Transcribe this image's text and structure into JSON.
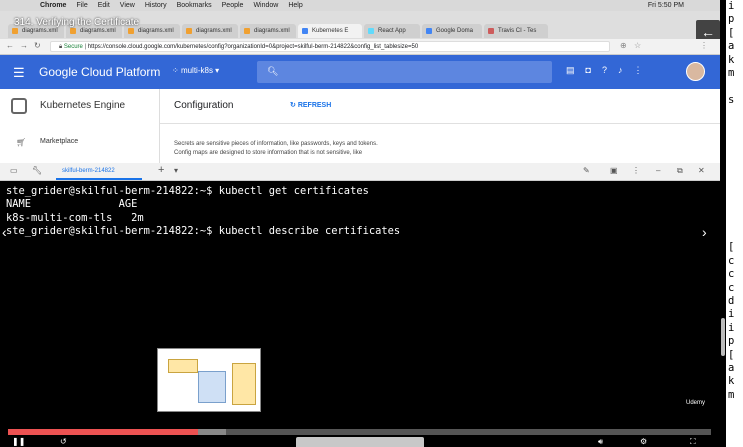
{
  "os_menubar": {
    "items": [
      "Chrome",
      "File",
      "Edit",
      "View",
      "History",
      "Bookmarks",
      "People",
      "Window",
      "Help"
    ],
    "clock": "Fri 5:50 PM"
  },
  "video": {
    "title": "314. Verifying the Certificate",
    "watermark": "Udemy",
    "progress_played": 0.27,
    "progress_loaded": 0.31
  },
  "browser": {
    "tabs": [
      {
        "label": "diagrams.xml",
        "color": "#f0a030"
      },
      {
        "label": "diagrams.xml",
        "color": "#f0a030"
      },
      {
        "label": "diagrams.xml",
        "color": "#f0a030"
      },
      {
        "label": "diagrams.xml",
        "color": "#f0a030"
      },
      {
        "label": "diagrams.xml",
        "color": "#f0a030"
      },
      {
        "label": "Kubernetes E",
        "color": "#4285f4"
      },
      {
        "label": "React App",
        "color": "#61dafb"
      },
      {
        "label": "Google Doma",
        "color": "#4285f4"
      },
      {
        "label": "Travis CI - Tes",
        "color": "#cd5c5c"
      }
    ],
    "secure_label": "Secure",
    "url": "https://console.cloud.google.com/kubernetes/config?organizationId=0&project=skilful-berm-214822&config_list_tablesize=50"
  },
  "gcp": {
    "brand": "Google Cloud Platform",
    "project": "multi-k8s",
    "sidebar": {
      "product": "Kubernetes Engine",
      "items": [
        "Marketplace"
      ]
    },
    "page_title": "Configuration",
    "refresh_label": "REFRESH",
    "description_lines": [
      "Secrets are sensitive pieces of information, like passwords, keys and tokens.",
      "Config maps are designed to store information that is not sensitive, like"
    ]
  },
  "cloud_shell": {
    "tab_label": "skilful-berm-214822",
    "add_tab": "+"
  },
  "terminal": {
    "lines": [
      "ste_grider@skilful-berm-214822:~$ kubectl get certificates",
      "NAME              AGE",
      "k8s-multi-com-tls   2m",
      "ste_grider@skilful-berm-214822:~$ kubectl describe certificates"
    ]
  },
  "right_strip": {
    "text": "i\np\n[\na\nk\nm\n\ns\n\n\n\n\n\n\n\n\n\n\n[\nc\nc\nc\nd\ni\ni\np\n[\na\nk\nm"
  }
}
